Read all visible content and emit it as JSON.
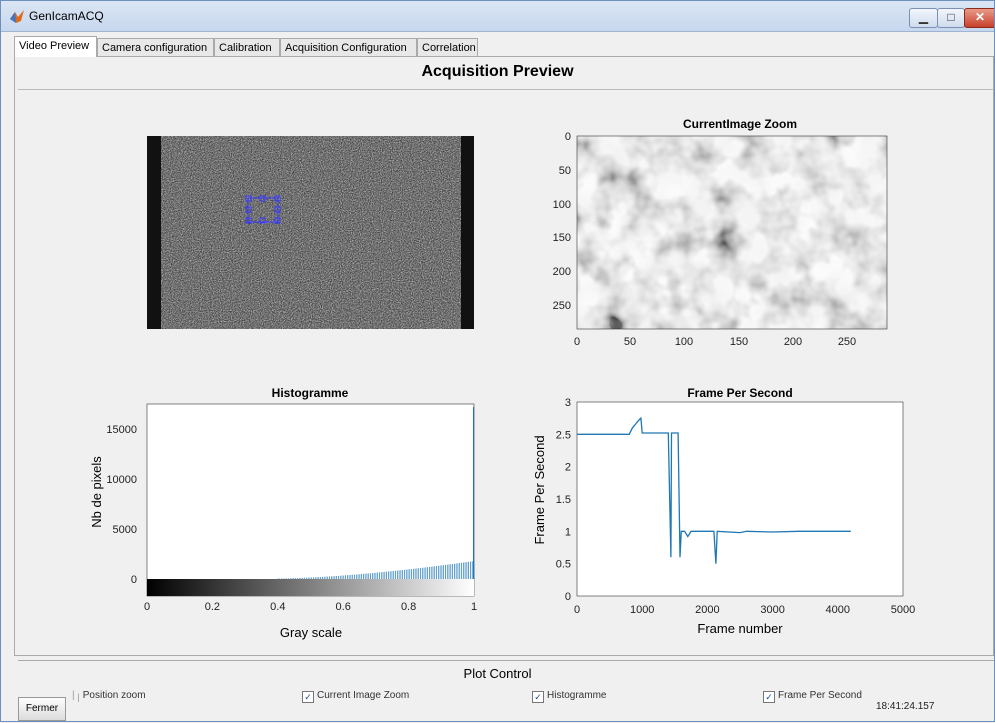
{
  "window": {
    "title": "GenIcamACQ"
  },
  "tabs": [
    "Video Preview",
    "Camera configuration",
    "Calibration",
    "Acquisition Configuration",
    "Correlation"
  ],
  "main": {
    "title": "Acquisition Preview"
  },
  "zoom_plot": {
    "title": "CurrentImage Zoom",
    "x_ticks": [
      "0",
      "50",
      "100",
      "150",
      "200",
      "250"
    ],
    "y_ticks": [
      "0",
      "50",
      "100",
      "150",
      "200",
      "250"
    ]
  },
  "chart_data": [
    {
      "type": "bar",
      "title": "Histogramme",
      "xlabel": "Gray scale",
      "ylabel": "Nb de pixels",
      "xlim": [
        0,
        1
      ],
      "ylim": [
        0,
        17500
      ],
      "x_ticks": [
        "0",
        "0.2",
        "0.4",
        "0.6",
        "0.8",
        "1"
      ],
      "y_ticks": [
        "0",
        "5000",
        "10000",
        "15000"
      ],
      "series": [
        {
          "x_start": 0.4,
          "x_end": 1.0,
          "y_start": 50,
          "y_end": 1800,
          "last_value": 17200
        }
      ]
    },
    {
      "type": "line",
      "title": "Frame Per Second",
      "xlabel": "Frame number",
      "ylabel": "Frame Per Second",
      "xlim": [
        0,
        5000
      ],
      "ylim": [
        0,
        3
      ],
      "x_ticks": [
        "0",
        "1000",
        "2000",
        "3000",
        "4000",
        "5000"
      ],
      "y_ticks": [
        "0",
        "0.5",
        "1",
        "1.5",
        "2",
        "2.5",
        "3"
      ],
      "x": [
        0,
        800,
        850,
        950,
        980,
        1000,
        1400,
        1440,
        1450,
        1460,
        1550,
        1580,
        1600,
        1650,
        1700,
        1750,
        2000,
        2100,
        2130,
        2150,
        2500,
        2600,
        3000,
        3400,
        4200
      ],
      "y": [
        2.5,
        2.5,
        2.6,
        2.72,
        2.75,
        2.52,
        2.52,
        0.6,
        2.52,
        2.52,
        2.52,
        0.6,
        1.0,
        1.0,
        0.92,
        1.0,
        1.0,
        1.0,
        0.5,
        1.0,
        0.98,
        1.0,
        0.99,
        1.0,
        1.0
      ]
    }
  ],
  "plot_control": {
    "title": "Plot Control",
    "checks": [
      {
        "label": "Position zoom",
        "checked": false
      },
      {
        "label": "Current Image Zoom",
        "checked": true
      },
      {
        "label": "Histogramme",
        "checked": true
      },
      {
        "label": "Frame Per Second",
        "checked": true
      }
    ],
    "close_label": "Fermer",
    "timestamp": "18:41:24.157"
  }
}
